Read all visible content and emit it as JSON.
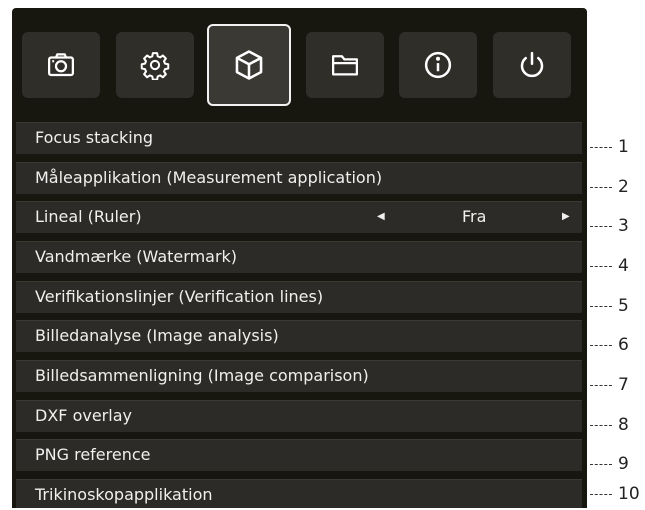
{
  "toolbar": {
    "buttons": [
      {
        "icon": "camera-icon",
        "active": false
      },
      {
        "icon": "gear-icon",
        "active": false
      },
      {
        "icon": "cube-icon",
        "active": true
      },
      {
        "icon": "folder-icon",
        "active": false
      },
      {
        "icon": "info-icon",
        "active": false
      },
      {
        "icon": "power-icon",
        "active": false
      }
    ]
  },
  "menu": {
    "items": [
      {
        "label": "Focus stacking"
      },
      {
        "label": "Måleapplikation (Measurement application)"
      },
      {
        "label": "Lineal (Ruler)",
        "value": "Fra",
        "left_arrow": "◀",
        "right_arrow": "▶"
      },
      {
        "label": "Vandmærke (Watermark)"
      },
      {
        "label": "Verifikationslinjer (Verification lines)"
      },
      {
        "label": "Billedanalyse (Image analysis)"
      },
      {
        "label": "Billedsammenligning (Image comparison)"
      },
      {
        "label": "DXF overlay"
      },
      {
        "label": "PNG reference"
      },
      {
        "label": "Trikinoskopapplikation"
      }
    ]
  },
  "callouts": [
    "1",
    "2",
    "3",
    "4",
    "5",
    "6",
    "7",
    "8",
    "9",
    "10"
  ],
  "colors": {
    "panel": "#17160f",
    "row": "#2c2b27",
    "button": "#2f2e29",
    "text": "#f0f0f0"
  }
}
